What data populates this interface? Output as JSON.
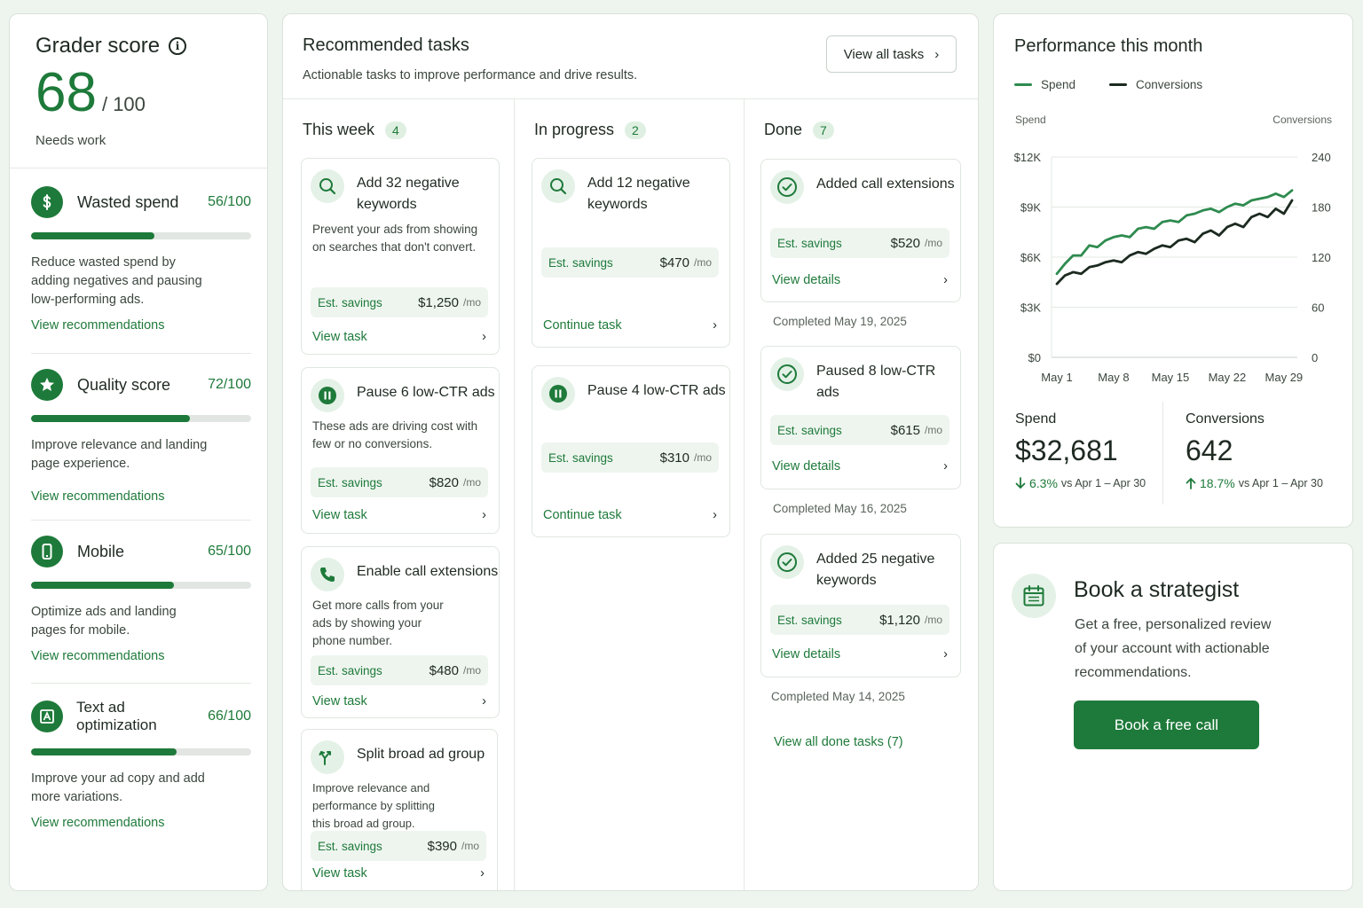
{
  "colors": {
    "brand": "#1e7a3a",
    "accent_bg": "#e4f1e7",
    "page_bg": "#eef4ee",
    "conversions_line": "#1c2a20"
  },
  "grader": {
    "title": "Grader score",
    "score": "68",
    "score_of": "/ 100",
    "status": "Needs work",
    "metrics": [
      {
        "icon": "dollar-icon",
        "name": "Wasted spend",
        "score": "56",
        "of": "/100",
        "progress": 0.56,
        "desc": "Reduce wasted spend by adding negatives and pausing low-performing ads.",
        "link": "View recommendations"
      },
      {
        "icon": "star-icon",
        "name": "Quality score",
        "score": "72",
        "of": "/100",
        "progress": 0.72,
        "desc": "Improve relevance and landing page experience.",
        "link": "View recommendations"
      },
      {
        "icon": "mobile-icon",
        "name": "Mobile",
        "score": "65",
        "of": "/100",
        "progress": 0.65,
        "desc": "Optimize ads and landing pages for mobile.",
        "link": "View recommendations"
      },
      {
        "icon": "text-ad-icon",
        "name": "Text ad optimization",
        "score": "66",
        "of": "/100",
        "progress": 0.66,
        "desc": "Improve your ad copy and add more variations.",
        "link": "View recommendations"
      }
    ]
  },
  "tasks": {
    "title": "Recommended tasks",
    "subtitle": "Actionable tasks to improve performance and drive results.",
    "view_all": "View all tasks",
    "savings_label": "Est. savings",
    "savings_unit": "/mo",
    "columns": [
      {
        "name": "This week",
        "count": "4",
        "items": [
          {
            "icon": "search-icon",
            "title": "Add 32 negative keywords",
            "desc": "Prevent your ads from showing on searches that don't convert.",
            "savings": "$1,250",
            "link": "View task"
          },
          {
            "icon": "pause-icon",
            "title": "Pause 6 low-CTR ads",
            "desc": "These ads are driving cost with few or no conversions.",
            "savings": "$820",
            "link": "View task"
          },
          {
            "icon": "phone-icon",
            "title": "Enable call extensions",
            "desc": "Get more calls from your ads by showing your phone number.",
            "savings": "$480",
            "link": "View task"
          },
          {
            "icon": "split-icon",
            "title": "Split broad ad group",
            "desc": "Improve relevance and performance by splitting this broad ad group.",
            "savings": "$390",
            "link": "View task"
          }
        ]
      },
      {
        "name": "In progress",
        "count": "2",
        "items": [
          {
            "icon": "search-icon",
            "title": "Add 12 negative keywords",
            "savings": "$470",
            "link": "Continue task"
          },
          {
            "icon": "pause-icon",
            "title": "Pause 4 low-CTR ads",
            "savings": "$310",
            "link": "Continue task"
          }
        ]
      },
      {
        "name": "Done",
        "count": "7",
        "items": [
          {
            "icon": "check-circle-icon",
            "title": "Added call extensions",
            "savings": "$520",
            "link": "View details",
            "completed": "Completed May 19, 2025"
          },
          {
            "icon": "check-circle-icon",
            "title": "Paused 8 low-CTR ads",
            "savings": "$615",
            "link": "View details",
            "completed": "Completed May 16, 2025"
          },
          {
            "icon": "check-circle-icon",
            "title": "Added 25 negative keywords",
            "savings": "$1,120",
            "link": "View details",
            "completed": "Completed May 14, 2025"
          }
        ],
        "view_all_done": "View all done tasks (7)"
      }
    ]
  },
  "performance": {
    "title": "Performance this month",
    "kpis": [
      {
        "label": "Spend",
        "value": "$32,681",
        "direction": "down",
        "delta": "6.3%",
        "vs": "vs Apr 1 – Apr 30"
      },
      {
        "label": "Conversions",
        "value": "642",
        "direction": "up",
        "delta": "18.7%",
        "vs": "vs Apr 1 – Apr 30"
      }
    ]
  },
  "chart_data": {
    "type": "line",
    "y_left_label": "Spend",
    "y_right_label": "Conversions",
    "y_left_ticks": [
      "$0",
      "$3K",
      "$6K",
      "$9K",
      "$12K"
    ],
    "y_right_ticks": [
      "0",
      "60",
      "120",
      "180",
      "240"
    ],
    "y_left_range": [
      0,
      12000
    ],
    "y_right_range": [
      0,
      240
    ],
    "x_ticks": [
      "May 1",
      "May 8",
      "May 15",
      "May 22",
      "May 29"
    ],
    "x_range": [
      1,
      30
    ],
    "grid": true,
    "legend_position": "top-left",
    "series": [
      {
        "name": "Spend",
        "axis": "left",
        "color": "#2e8b4f",
        "x": [
          1,
          2,
          3,
          4,
          5,
          6,
          7,
          8,
          9,
          10,
          11,
          12,
          13,
          14,
          15,
          16,
          17,
          18,
          19,
          20,
          21,
          22,
          23,
          24,
          25,
          26,
          27,
          28,
          29,
          30
        ],
        "values": [
          5000,
          5600,
          6100,
          6100,
          6700,
          6600,
          7000,
          7200,
          7300,
          7200,
          7700,
          7800,
          7700,
          8100,
          8200,
          8100,
          8500,
          8600,
          8800,
          8900,
          8700,
          9000,
          9200,
          9100,
          9400,
          9500,
          9600,
          9800,
          9600,
          10000
        ]
      },
      {
        "name": "Conversions",
        "axis": "right",
        "color": "#1c2a20",
        "x": [
          1,
          2,
          3,
          4,
          5,
          6,
          7,
          8,
          9,
          10,
          11,
          12,
          13,
          14,
          15,
          16,
          17,
          18,
          19,
          20,
          21,
          22,
          23,
          24,
          25,
          26,
          27,
          28,
          29,
          30
        ],
        "values": [
          88,
          98,
          102,
          100,
          108,
          110,
          114,
          116,
          114,
          122,
          126,
          124,
          130,
          134,
          132,
          140,
          142,
          138,
          148,
          152,
          146,
          156,
          160,
          156,
          168,
          172,
          168,
          178,
          172,
          188
        ]
      }
    ]
  },
  "strategist": {
    "title": "Book a strategist",
    "desc": "Get a free, personalized review of your account with actionable recommendations.",
    "button": "Book a free call"
  }
}
